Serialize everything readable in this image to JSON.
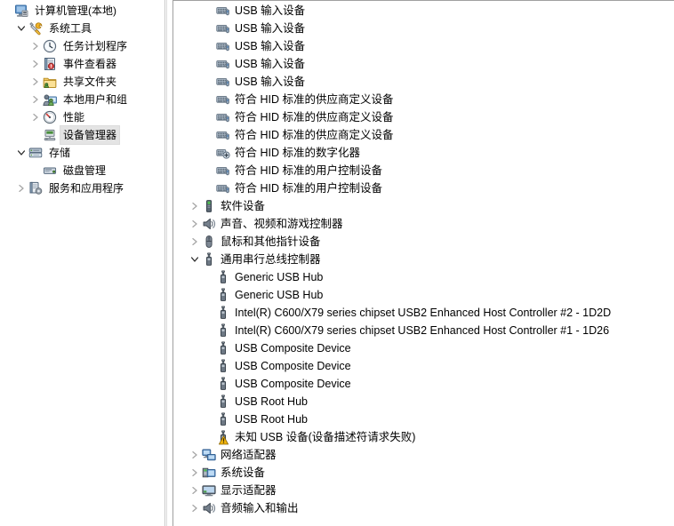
{
  "window": {
    "title": "计算机管理",
    "accent": "#3a7cc4",
    "selection_bg": "#e4e4e4"
  },
  "sidebar": {
    "items": [
      {
        "label": "计算机管理(本地)",
        "icon": "computer-management-icon",
        "twist": "none",
        "depth": 0,
        "selected": false
      },
      {
        "label": "系统工具",
        "icon": "system-tools-icon",
        "twist": "expanded",
        "depth": 1,
        "selected": false
      },
      {
        "label": "任务计划程序",
        "icon": "task-scheduler-icon",
        "twist": "collapsed",
        "depth": 2,
        "selected": false
      },
      {
        "label": "事件查看器",
        "icon": "event-viewer-icon",
        "twist": "collapsed",
        "depth": 2,
        "selected": false
      },
      {
        "label": "共享文件夹",
        "icon": "shared-folders-icon",
        "twist": "collapsed",
        "depth": 2,
        "selected": false
      },
      {
        "label": "本地用户和组",
        "icon": "local-users-groups-icon",
        "twist": "collapsed",
        "depth": 2,
        "selected": false
      },
      {
        "label": "性能",
        "icon": "performance-icon",
        "twist": "collapsed",
        "depth": 2,
        "selected": false
      },
      {
        "label": "设备管理器",
        "icon": "device-manager-icon",
        "twist": "none",
        "depth": 2,
        "selected": true
      },
      {
        "label": "存储",
        "icon": "storage-icon",
        "twist": "expanded",
        "depth": 1,
        "selected": false
      },
      {
        "label": "磁盘管理",
        "icon": "disk-management-icon",
        "twist": "none",
        "depth": 2,
        "selected": false
      },
      {
        "label": "服务和应用程序",
        "icon": "services-applications-icon",
        "twist": "collapsed",
        "depth": 1,
        "selected": false
      }
    ]
  },
  "device_list": {
    "rows": [
      {
        "label": "USB 输入设备",
        "icon": "hid-device-icon",
        "twist": "none",
        "level": 2,
        "warning": false
      },
      {
        "label": "USB 输入设备",
        "icon": "hid-device-icon",
        "twist": "none",
        "level": 2,
        "warning": false
      },
      {
        "label": "USB 输入设备",
        "icon": "hid-device-icon",
        "twist": "none",
        "level": 2,
        "warning": false
      },
      {
        "label": "USB 输入设备",
        "icon": "hid-device-icon",
        "twist": "none",
        "level": 2,
        "warning": false
      },
      {
        "label": "USB 输入设备",
        "icon": "hid-device-icon",
        "twist": "none",
        "level": 2,
        "warning": false
      },
      {
        "label": "符合 HID 标准的供应商定义设备",
        "icon": "hid-device-icon",
        "twist": "none",
        "level": 2,
        "warning": false
      },
      {
        "label": "符合 HID 标准的供应商定义设备",
        "icon": "hid-device-icon",
        "twist": "none",
        "level": 2,
        "warning": false
      },
      {
        "label": "符合 HID 标准的供应商定义设备",
        "icon": "hid-device-icon",
        "twist": "none",
        "level": 2,
        "warning": false
      },
      {
        "label": "符合 HID 标准的数字化器",
        "icon": "hid-digitizer-icon",
        "twist": "none",
        "level": 2,
        "warning": false
      },
      {
        "label": "符合 HID 标准的用户控制设备",
        "icon": "hid-device-icon",
        "twist": "none",
        "level": 2,
        "warning": false
      },
      {
        "label": "符合 HID 标准的用户控制设备",
        "icon": "hid-device-icon",
        "twist": "none",
        "level": 2,
        "warning": false
      },
      {
        "label": "软件设备",
        "icon": "software-device-icon",
        "twist": "collapsed",
        "level": 1,
        "warning": false
      },
      {
        "label": "声音、视频和游戏控制器",
        "icon": "sound-video-game-icon",
        "twist": "collapsed",
        "level": 1,
        "warning": false
      },
      {
        "label": "鼠标和其他指针设备",
        "icon": "mouse-icon",
        "twist": "collapsed",
        "level": 1,
        "warning": false
      },
      {
        "label": "通用串行总线控制器",
        "icon": "usb-icon",
        "twist": "expanded",
        "level": 1,
        "warning": false
      },
      {
        "label": "Generic USB Hub",
        "icon": "usb-hub-icon",
        "twist": "none",
        "level": 2,
        "warning": false
      },
      {
        "label": "Generic USB Hub",
        "icon": "usb-hub-icon",
        "twist": "none",
        "level": 2,
        "warning": false
      },
      {
        "label": "Intel(R) C600/X79 series chipset USB2 Enhanced Host Controller #2 - 1D2D",
        "icon": "usb-hub-icon",
        "twist": "none",
        "level": 2,
        "warning": false
      },
      {
        "label": "Intel(R) C600/X79 series chipset USB2 Enhanced Host Controller #1 - 1D26",
        "icon": "usb-hub-icon",
        "twist": "none",
        "level": 2,
        "warning": false
      },
      {
        "label": "USB Composite Device",
        "icon": "usb-hub-icon",
        "twist": "none",
        "level": 2,
        "warning": false
      },
      {
        "label": "USB Composite Device",
        "icon": "usb-hub-icon",
        "twist": "none",
        "level": 2,
        "warning": false
      },
      {
        "label": "USB Composite Device",
        "icon": "usb-hub-icon",
        "twist": "none",
        "level": 2,
        "warning": false
      },
      {
        "label": "USB Root Hub",
        "icon": "usb-hub-icon",
        "twist": "none",
        "level": 2,
        "warning": false
      },
      {
        "label": "USB Root Hub",
        "icon": "usb-hub-icon",
        "twist": "none",
        "level": 2,
        "warning": false
      },
      {
        "label": "未知 USB 设备(设备描述符请求失败)",
        "icon": "usb-hub-icon",
        "twist": "none",
        "level": 2,
        "warning": true
      },
      {
        "label": "网络适配器",
        "icon": "network-adapter-icon",
        "twist": "collapsed",
        "level": 1,
        "warning": false
      },
      {
        "label": "系统设备",
        "icon": "system-device-icon",
        "twist": "collapsed",
        "level": 1,
        "warning": false
      },
      {
        "label": "显示适配器",
        "icon": "display-adapter-icon",
        "twist": "collapsed",
        "level": 1,
        "warning": false
      },
      {
        "label": "音频输入和输出",
        "icon": "audio-io-icon",
        "twist": "collapsed",
        "level": 1,
        "warning": false
      }
    ]
  }
}
